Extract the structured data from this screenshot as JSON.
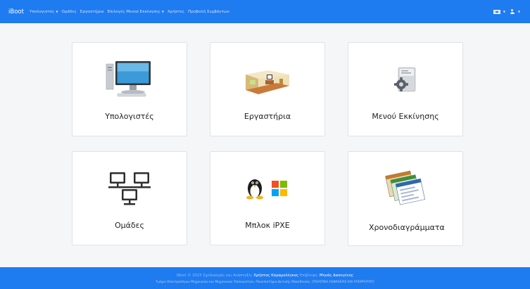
{
  "navbar": {
    "brand": "iBoot",
    "items": [
      {
        "label": "Υπολογιστές",
        "caret": "▼"
      },
      {
        "label": "Ομάδες"
      },
      {
        "label": "Εργαστήρια"
      },
      {
        "label": "Επιλογές Μενού Εκκίνησης",
        "caret": "▼"
      },
      {
        "label": "Χρήστες"
      },
      {
        "label": "Προβολή Συμβάντων"
      }
    ],
    "right": {
      "language_caret": "▼",
      "user_caret": "▼"
    }
  },
  "cards": [
    {
      "title": "Υπολογιστές",
      "icon": "computer-icon"
    },
    {
      "title": "Εργαστήρια",
      "icon": "lab-room-icon"
    },
    {
      "title": "Μενού Εκκίνησης",
      "icon": "boot-menu-gear-icon"
    },
    {
      "title": "Ομάδες",
      "icon": "network-group-icon"
    },
    {
      "title": "Μπλοκ iPXE",
      "icon": "linux-windows-icon"
    },
    {
      "title": "Χρονοδιαγράμματα",
      "icon": "schedules-windows-icon"
    }
  ],
  "footer": {
    "line1_prefix": "iBoot © 2023 Σχεδιασμός και Ανάπτυξη:",
    "author": "Χρήστος Καραμολέγκος",
    "supervision_label": "Επίβλεψη:",
    "supervisor": "Μηνάς Δασυγένης",
    "line2": "Τμήμα Ηλεκτρολόγων Μηχανικών και Μηχανικών Υπολογιστών, Πανεπιστήμιο Δυτικής Μακεδονίας",
    "policy_link": "[ΠΟΛΙΤΙΚΗ ΑΣΦΑΛΕΙΑΣ ΚΑΙ ΑΠΟΡΡΗΤΟΥ]"
  },
  "colors": {
    "primary": "#1f7bf0",
    "background": "#f5f6f8",
    "card": "#ffffff"
  }
}
